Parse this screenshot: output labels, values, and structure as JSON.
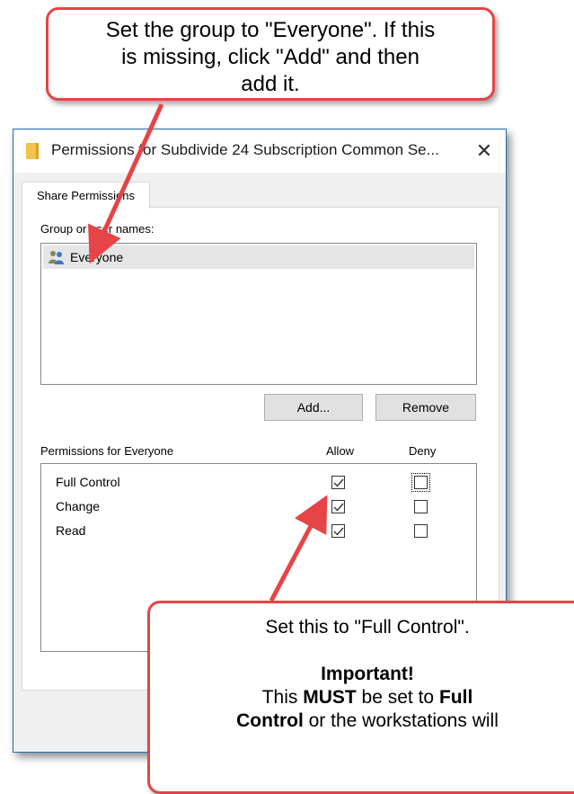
{
  "window": {
    "title": "Permissions for Subdivide 24 Subscription Common Se...",
    "close_glyph": "✕"
  },
  "tabs": [
    {
      "label": "Share Permissions"
    }
  ],
  "group_section": {
    "label": "Group or user names:",
    "items": [
      {
        "label": "Everyone",
        "icon": "users-icon",
        "selected": true
      }
    ]
  },
  "buttons": {
    "add": "Add...",
    "remove": "Remove"
  },
  "permissions": {
    "label": "Permissions for Everyone",
    "allow_header": "Allow",
    "deny_header": "Deny",
    "rows": [
      {
        "label": "Full Control",
        "allow": true,
        "deny": false
      },
      {
        "label": "Change",
        "allow": true,
        "deny": false
      },
      {
        "label": "Read",
        "allow": true,
        "deny": false
      }
    ]
  },
  "callouts": {
    "top": {
      "line1": "Set the group to \"Everyone\". If this",
      "line2": "is missing, click \"Add\" and then",
      "line3": "add it."
    },
    "bottom": {
      "line1": "Set this to \"Full Control\".",
      "important": "Important!",
      "line3_a": "This ",
      "line3_b": "MUST",
      "line3_c": " be set to ",
      "line3_d": "Full",
      "line4_a": "Control",
      "line4_b": " or the workstations will"
    }
  },
  "colors": {
    "callout_border": "#e64446",
    "arrow": "#e64446",
    "window_border": "#1f6fb5"
  }
}
